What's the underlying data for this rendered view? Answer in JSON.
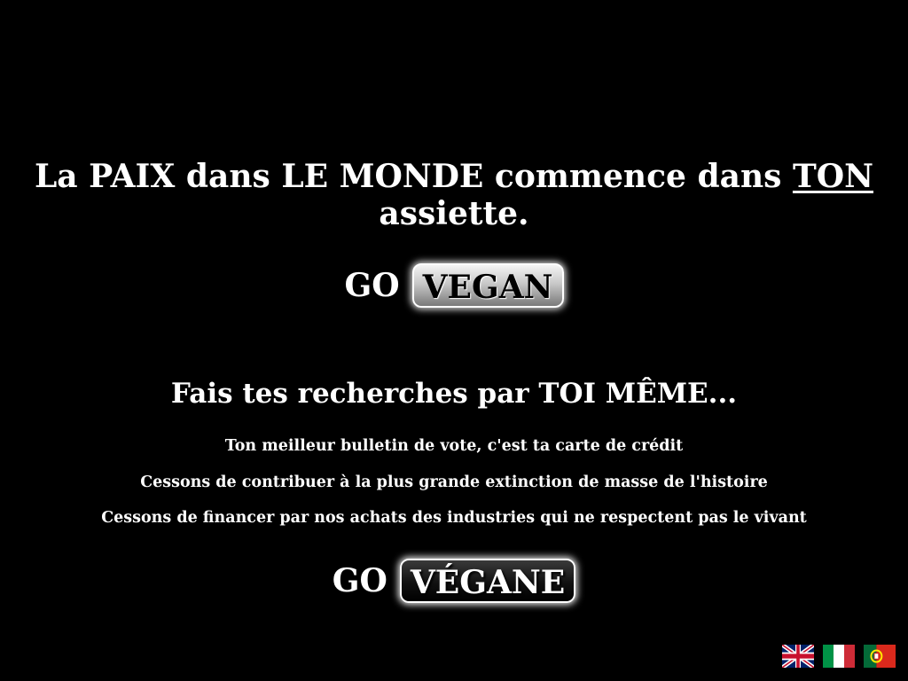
{
  "headline": {
    "part1": "La PAIX dans LE MONDE commence dans ",
    "emphasis": "TON",
    "part2": "assiette."
  },
  "cta_primary": {
    "go_label": "GO",
    "button_label": "VEGAN"
  },
  "subhead": "Fais tes recherches par TOI MÊME...",
  "messages": [
    "Ton meilleur bulletin de vote, c'est ta carte de crédit",
    "Cessons de contribuer à la plus grande extinction de masse de l'histoire",
    "Cessons de financer par nos achats des industries qui ne respectent pas le vivant"
  ],
  "cta_secondary": {
    "go_label": "GO",
    "button_label": "VÉGANE"
  },
  "languages": [
    {
      "name": "uk-flag-icon"
    },
    {
      "name": "italy-flag-icon"
    },
    {
      "name": "portugal-flag-icon"
    }
  ],
  "colors": {
    "background": "#000000",
    "text": "#ffffff"
  }
}
